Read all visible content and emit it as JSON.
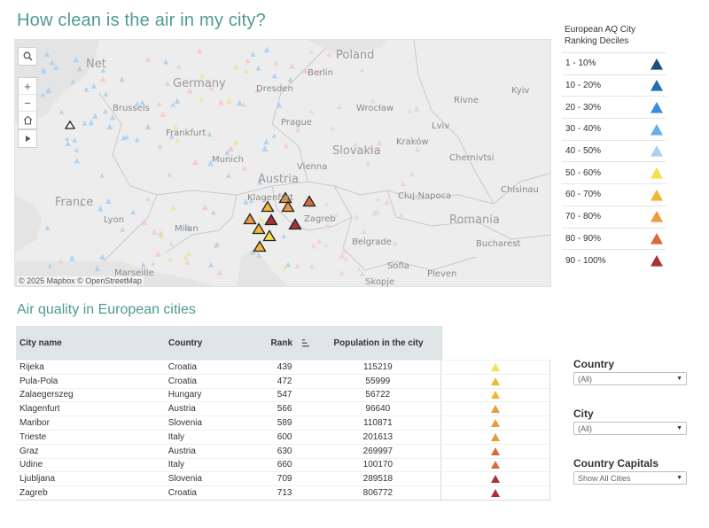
{
  "title": "How clean is the air in my city?",
  "subtitle": "Air quality in European cities",
  "map": {
    "attribution": "© 2025 Mapbox  © OpenStreetMap",
    "controls": [
      "search-icon",
      "zoom-in-icon",
      "zoom-out-icon",
      "home-icon",
      "play-icon"
    ],
    "labels": [
      {
        "text": "Net",
        "kind": "country"
      },
      {
        "text": "Germany",
        "kind": "country"
      },
      {
        "text": "Poland",
        "kind": "country"
      },
      {
        "text": "France",
        "kind": "country"
      },
      {
        "text": "Austria",
        "kind": "country"
      },
      {
        "text": "Slovakia",
        "kind": "country"
      },
      {
        "text": "Romania",
        "kind": "country"
      },
      {
        "text": "Berlin",
        "kind": "city"
      },
      {
        "text": "Dresden",
        "kind": "city"
      },
      {
        "text": "Wrocław",
        "kind": "city"
      },
      {
        "text": "Kraków",
        "kind": "city"
      },
      {
        "text": "Rivne",
        "kind": "city"
      },
      {
        "text": "Kyiv",
        "kind": "city"
      },
      {
        "text": "Lviv",
        "kind": "city"
      },
      {
        "text": "Chernivtsi",
        "kind": "city"
      },
      {
        "text": "Chisinau",
        "kind": "city"
      },
      {
        "text": "Cluj-Napoca",
        "kind": "city"
      },
      {
        "text": "Bucharest",
        "kind": "city"
      },
      {
        "text": "Belgrade",
        "kind": "city"
      },
      {
        "text": "Sofia",
        "kind": "city"
      },
      {
        "text": "Pleven",
        "kind": "city"
      },
      {
        "text": "Prague",
        "kind": "city"
      },
      {
        "text": "Vienna",
        "kind": "city"
      },
      {
        "text": "Klagenfurt",
        "kind": "city"
      },
      {
        "text": "Zagreb",
        "kind": "city"
      },
      {
        "text": "Lyon",
        "kind": "city"
      },
      {
        "text": "Milan",
        "kind": "city"
      },
      {
        "text": "Marseille",
        "kind": "city"
      },
      {
        "text": "Brussels",
        "kind": "city"
      },
      {
        "text": "Frankfurt",
        "kind": "city"
      },
      {
        "text": "Munich",
        "kind": "city"
      },
      {
        "text": "Skopje",
        "kind": "city"
      }
    ],
    "highlighted_cities": [
      "Rijeka",
      "Pula-Pola",
      "Zalaegerszeg",
      "Klagenfurt",
      "Maribor",
      "Trieste",
      "Graz",
      "Udine",
      "Ljubljana",
      "Zagreb"
    ]
  },
  "legend": {
    "title": "European AQ City Ranking Deciles",
    "items": [
      {
        "label": "1 - 10%",
        "color": "#1f4e79"
      },
      {
        "label": "10 - 20%",
        "color": "#1f6fb2"
      },
      {
        "label": "20 - 30%",
        "color": "#3a8ddb"
      },
      {
        "label": "30 - 40%",
        "color": "#66aee8"
      },
      {
        "label": "40 - 50%",
        "color": "#a8d1f0"
      },
      {
        "label": "50 - 60%",
        "color": "#f4e04d"
      },
      {
        "label": "60 - 70%",
        "color": "#f2b632"
      },
      {
        "label": "70 - 80%",
        "color": "#ec9a3b"
      },
      {
        "label": "80 - 90%",
        "color": "#d96b3a"
      },
      {
        "label": "90 - 100%",
        "color": "#a8323a"
      }
    ]
  },
  "table": {
    "headers": {
      "name": "City name",
      "country": "Country",
      "rank": "Rank",
      "population": "Population in the city"
    },
    "rows": [
      {
        "name": "Rijeka",
        "country": "Croatia",
        "rank": "439",
        "population": "115219",
        "color": "#f4e04d"
      },
      {
        "name": "Pula-Pola",
        "country": "Croatia",
        "rank": "472",
        "population": "55999",
        "color": "#f2b632"
      },
      {
        "name": "Zalaegerszeg",
        "country": "Hungary",
        "rank": "547",
        "population": "56722",
        "color": "#f2b632"
      },
      {
        "name": "Klagenfurt",
        "country": "Austria",
        "rank": "566",
        "population": "96640",
        "color": "#ec9a3b"
      },
      {
        "name": "Maribor",
        "country": "Slovenia",
        "rank": "589",
        "population": "110871",
        "color": "#ec9a3b"
      },
      {
        "name": "Trieste",
        "country": "Italy",
        "rank": "600",
        "population": "201613",
        "color": "#ec9a3b"
      },
      {
        "name": "Graz",
        "country": "Austria",
        "rank": "630",
        "population": "269997",
        "color": "#d96b3a"
      },
      {
        "name": "Udine",
        "country": "Italy",
        "rank": "660",
        "population": "100170",
        "color": "#d96b3a"
      },
      {
        "name": "Ljubljana",
        "country": "Slovenia",
        "rank": "709",
        "population": "289518",
        "color": "#a8323a"
      },
      {
        "name": "Zagreb",
        "country": "Croatia",
        "rank": "713",
        "population": "806772",
        "color": "#a8323a"
      }
    ]
  },
  "filters": {
    "country": {
      "label": "Country",
      "value": "(All)"
    },
    "city": {
      "label": "City",
      "value": "(All)"
    },
    "capitals": {
      "label": "Country Capitals",
      "value": "Show All Cities"
    }
  }
}
